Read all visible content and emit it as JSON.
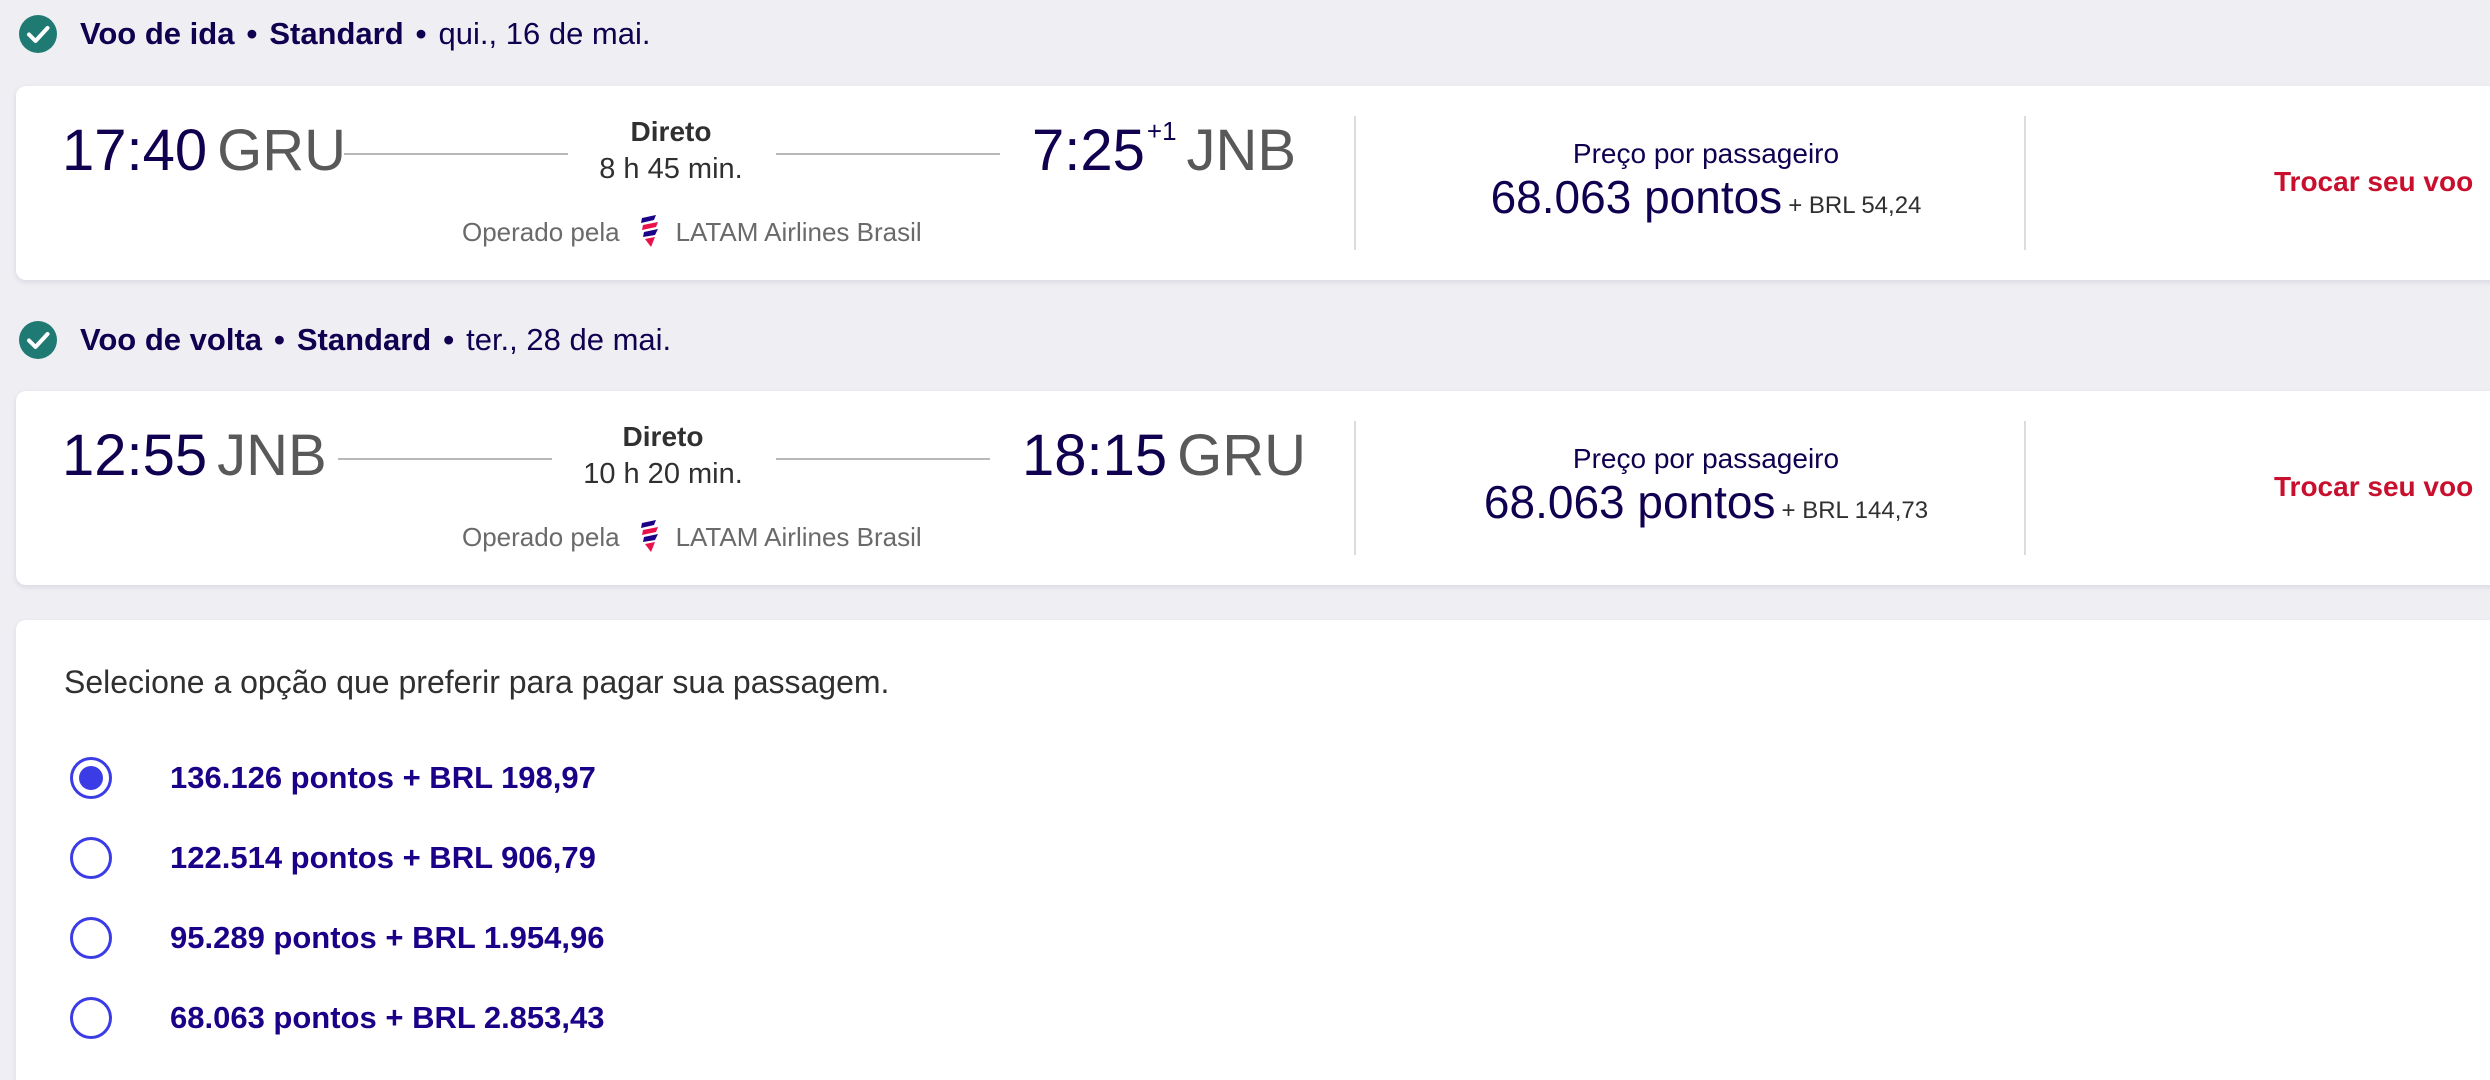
{
  "outbound": {
    "header": {
      "title": "Voo de ida",
      "separator": "•",
      "fare": "Standard",
      "date": "qui., 16 de mai."
    },
    "departure_time": "17:40",
    "departure_code": "GRU",
    "stops_label": "Direto",
    "duration": "8 h 45 min.",
    "arrival_time": "7:25",
    "arrival_day_offset": "+1",
    "arrival_code": "JNB",
    "operated_label": "Operado pela",
    "operator": "LATAM Airlines Brasil",
    "price_label": "Preço por passageiro",
    "price_points": "68.063 pontos",
    "price_brl": "+ BRL 54,24",
    "change_label": "Trocar seu voo"
  },
  "return": {
    "header": {
      "title": "Voo de volta",
      "separator": "•",
      "fare": "Standard",
      "date": "ter., 28 de mai."
    },
    "departure_time": "12:55",
    "departure_code": "JNB",
    "stops_label": "Direto",
    "duration": "10 h 20 min.",
    "arrival_time": "18:15",
    "arrival_code": "GRU",
    "operated_label": "Operado pela",
    "operator": "LATAM Airlines Brasil",
    "price_label": "Preço por passageiro",
    "price_points": "68.063 pontos",
    "price_brl": "+ BRL 144,73",
    "change_label": "Trocar seu voo"
  },
  "payment": {
    "prompt": "Selecione a opção que preferir para pagar sua passagem.",
    "options": [
      {
        "label": "136.126 pontos + BRL 198,97",
        "selected": true
      },
      {
        "label": "122.514 pontos + BRL 906,79",
        "selected": false
      },
      {
        "label": "95.289 pontos + BRL 1.954,96",
        "selected": false
      },
      {
        "label": "68.063 pontos + BRL 2.853,43",
        "selected": false
      }
    ]
  },
  "icons": {
    "check": "check-circle-icon",
    "airline_logo": "latam-logo-icon"
  },
  "colors": {
    "check_green": "#1f7a74",
    "text_navy": "#10004f",
    "link_red": "#c8102e",
    "radio_blue": "#3c3ce6",
    "option_text": "#1b0088",
    "page_bg": "#eeeef3"
  }
}
